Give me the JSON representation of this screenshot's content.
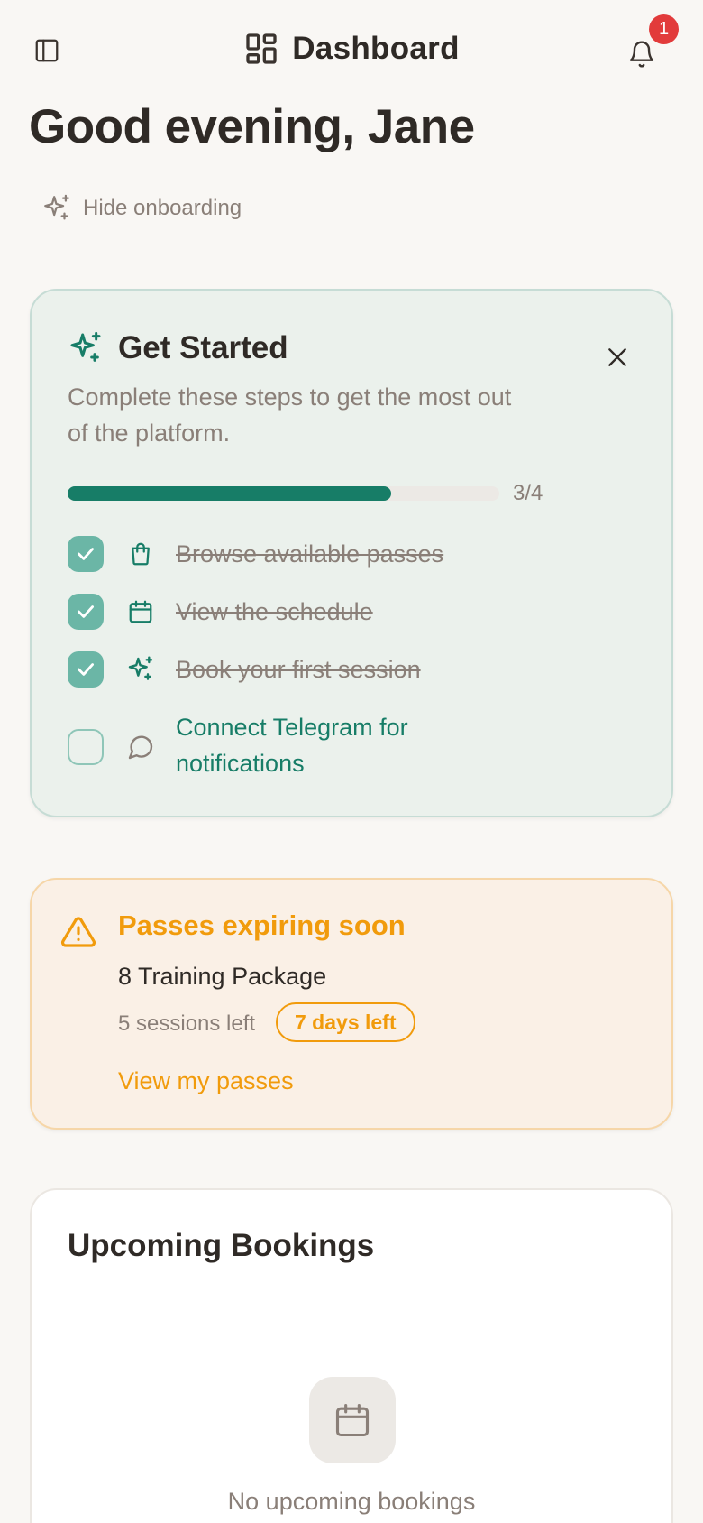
{
  "header": {
    "title": "Dashboard",
    "notification_count": "1",
    "icons": {
      "sidebar": "sidebar-toggle-icon",
      "app": "dashboard-grid-icon",
      "notifications": "bell-icon"
    }
  },
  "greeting": "Good evening, Jane",
  "hide_onboarding": {
    "label": "Hide onboarding",
    "icon": "sparkles-icon"
  },
  "onboarding": {
    "title": "Get Started",
    "description": "Complete these steps to get the most out of the platform.",
    "progress": {
      "completed": 3,
      "total": 4,
      "label": "3/4"
    },
    "steps": [
      {
        "label": "Browse available passes",
        "icon": "shopping-bag-icon",
        "done": true
      },
      {
        "label": "View the schedule",
        "icon": "calendar-icon",
        "done": true
      },
      {
        "label": "Book your first session",
        "icon": "sparkles-icon",
        "done": true
      },
      {
        "label": "Connect Telegram for notifications",
        "icon": "message-circle-icon",
        "done": false
      }
    ]
  },
  "expiring": {
    "title": "Passes expiring soon",
    "package": "8 Training Package",
    "sessions_left": "5 sessions left",
    "days_left": "7 days left",
    "link": "View my passes",
    "icon": "warning-triangle-icon"
  },
  "bookings": {
    "title": "Upcoming Bookings",
    "empty_text": "No upcoming bookings",
    "icon": "calendar-icon"
  },
  "colors": {
    "background": "#f9f7f4",
    "text": "#2f2a26",
    "muted": "#8a7f78",
    "accent": "#177d67",
    "warning": "#f19b0c",
    "badge": "#e23b3b"
  }
}
